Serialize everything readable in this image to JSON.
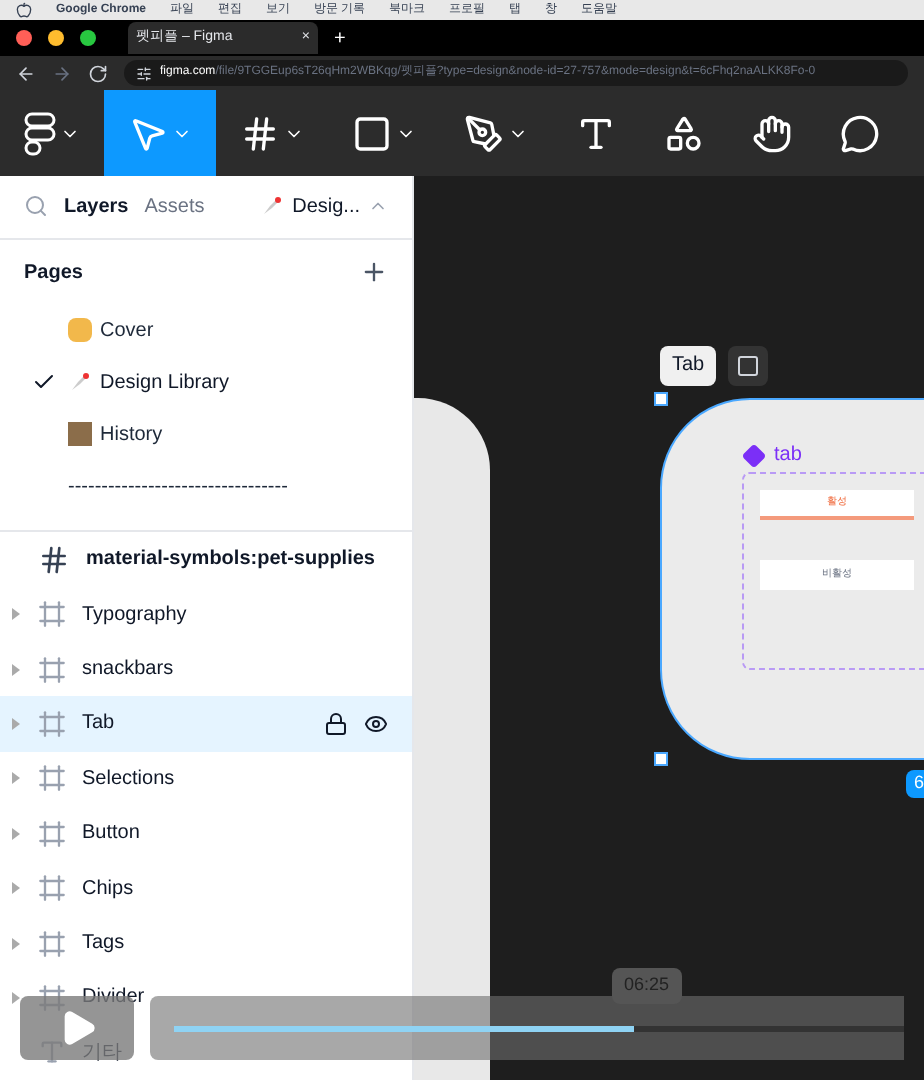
{
  "mac_menu": [
    "Google Chrome",
    "파일",
    "편집",
    "보기",
    "방문 기록",
    "북마크",
    "프로필",
    "탭",
    "창",
    "도움말"
  ],
  "browser": {
    "tab_title": "펫피플 – Figma",
    "tab_close": "×",
    "new_tab": "+",
    "url_host": "figma.com",
    "url_path": "/file/9TGGEup6sT26qHm2WBKqg/펫피플?type=design&node-id=27-757&mode=design&t=6cFhq2naALKK8Fo-0"
  },
  "tools": [
    {
      "kind": "logo",
      "selected": false
    },
    {
      "kind": "move",
      "selected": true
    },
    {
      "kind": "frame",
      "selected": false
    },
    {
      "kind": "shape",
      "selected": false
    },
    {
      "kind": "pen",
      "selected": false
    },
    {
      "kind": "text",
      "selected": false
    },
    {
      "kind": "resources",
      "selected": false
    },
    {
      "kind": "hand",
      "selected": false
    },
    {
      "kind": "comment",
      "selected": false
    }
  ],
  "panel_tabs": [
    {
      "label": "Layers",
      "selected": true
    },
    {
      "label": "Assets",
      "selected": false
    }
  ],
  "page_switcher": "Desig...",
  "pages_title": "Pages",
  "pages": [
    {
      "name": "Cover",
      "selected": false
    },
    {
      "name": "Design Library",
      "selected": true
    },
    {
      "name": "History",
      "selected": false
    },
    {
      "name": "---------------------------------",
      "selected": false
    }
  ],
  "layers": [
    {
      "name": "material-symbols:pet-supplies",
      "kind": "frame",
      "selected": false
    },
    {
      "name": "Typography",
      "kind": "section",
      "selected": false
    },
    {
      "name": "snackbars",
      "kind": "section",
      "selected": false
    },
    {
      "name": "Tab",
      "kind": "section",
      "selected": true
    },
    {
      "name": "Selections",
      "kind": "section",
      "selected": false
    },
    {
      "name": "Button",
      "kind": "section",
      "selected": false
    },
    {
      "name": "Chips",
      "kind": "section",
      "selected": false
    },
    {
      "name": "Tags",
      "kind": "section",
      "selected": false
    },
    {
      "name": "Divider",
      "kind": "section",
      "selected": false
    },
    {
      "name": "기타",
      "kind": "text",
      "selected": false
    }
  ],
  "canvas": {
    "frame_label": "Tab",
    "component_name": "tab",
    "tabs": [
      {
        "label": "활성",
        "selected": true
      },
      {
        "label": "비활성",
        "selected": false
      }
    ],
    "size_badge": "6"
  },
  "video": {
    "time": "06:25",
    "level": 0.63
  }
}
